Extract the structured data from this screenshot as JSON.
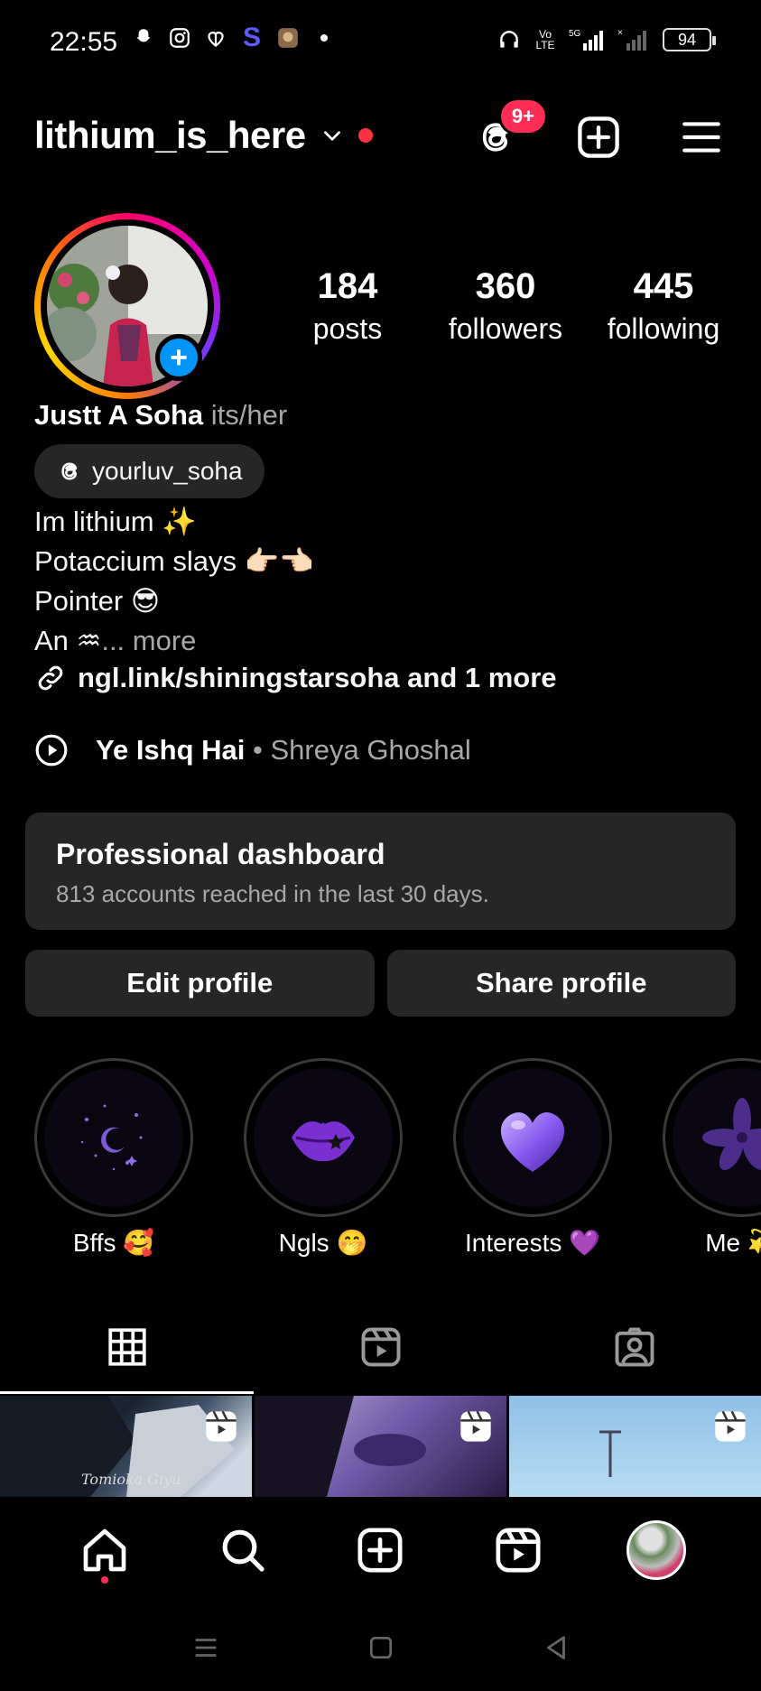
{
  "status_bar": {
    "time": "22:55",
    "battery": "94",
    "network": "5G"
  },
  "header": {
    "username": "lithium_is_here",
    "notification_badge": "9+"
  },
  "profile": {
    "stats": [
      {
        "value": "184",
        "label": "posts"
      },
      {
        "value": "360",
        "label": "followers"
      },
      {
        "value": "445",
        "label": "following"
      }
    ],
    "name": "Justt A Soha",
    "pronouns": "its/her",
    "threads_handle": "yourluv_soha",
    "bio_lines": [
      "Im lithium ✨",
      "Potaccium slays 👉🏻👈🏻",
      "Pointer 😎"
    ],
    "bio_last_line": "An ♒",
    "bio_more": "... more",
    "link": "ngl.link/shiningstarsoha and 1 more"
  },
  "music": {
    "title": "Ye Ishq Hai",
    "separator": " • ",
    "artist": "Shreya Ghoshal"
  },
  "dashboard": {
    "title": "Professional dashboard",
    "subtitle": "813 accounts reached in the last 30 days."
  },
  "actions": {
    "edit_label": "Edit profile",
    "share_label": "Share profile"
  },
  "highlights": [
    {
      "label": "Bffs 🥰",
      "icon": "moon-stars-icon"
    },
    {
      "label": "Ngls 🤭",
      "icon": "lips-icon"
    },
    {
      "label": "Interests 💜",
      "icon": "heart-icon"
    },
    {
      "label": "Me 💫",
      "icon": "flower-icon"
    }
  ],
  "grid": {
    "cell1_text": "Tomioka Giyu"
  },
  "colors": {
    "accent": "#0095f6",
    "notification": "#ff2d55",
    "card": "#262626",
    "muted_text": "#a8a8a8"
  }
}
